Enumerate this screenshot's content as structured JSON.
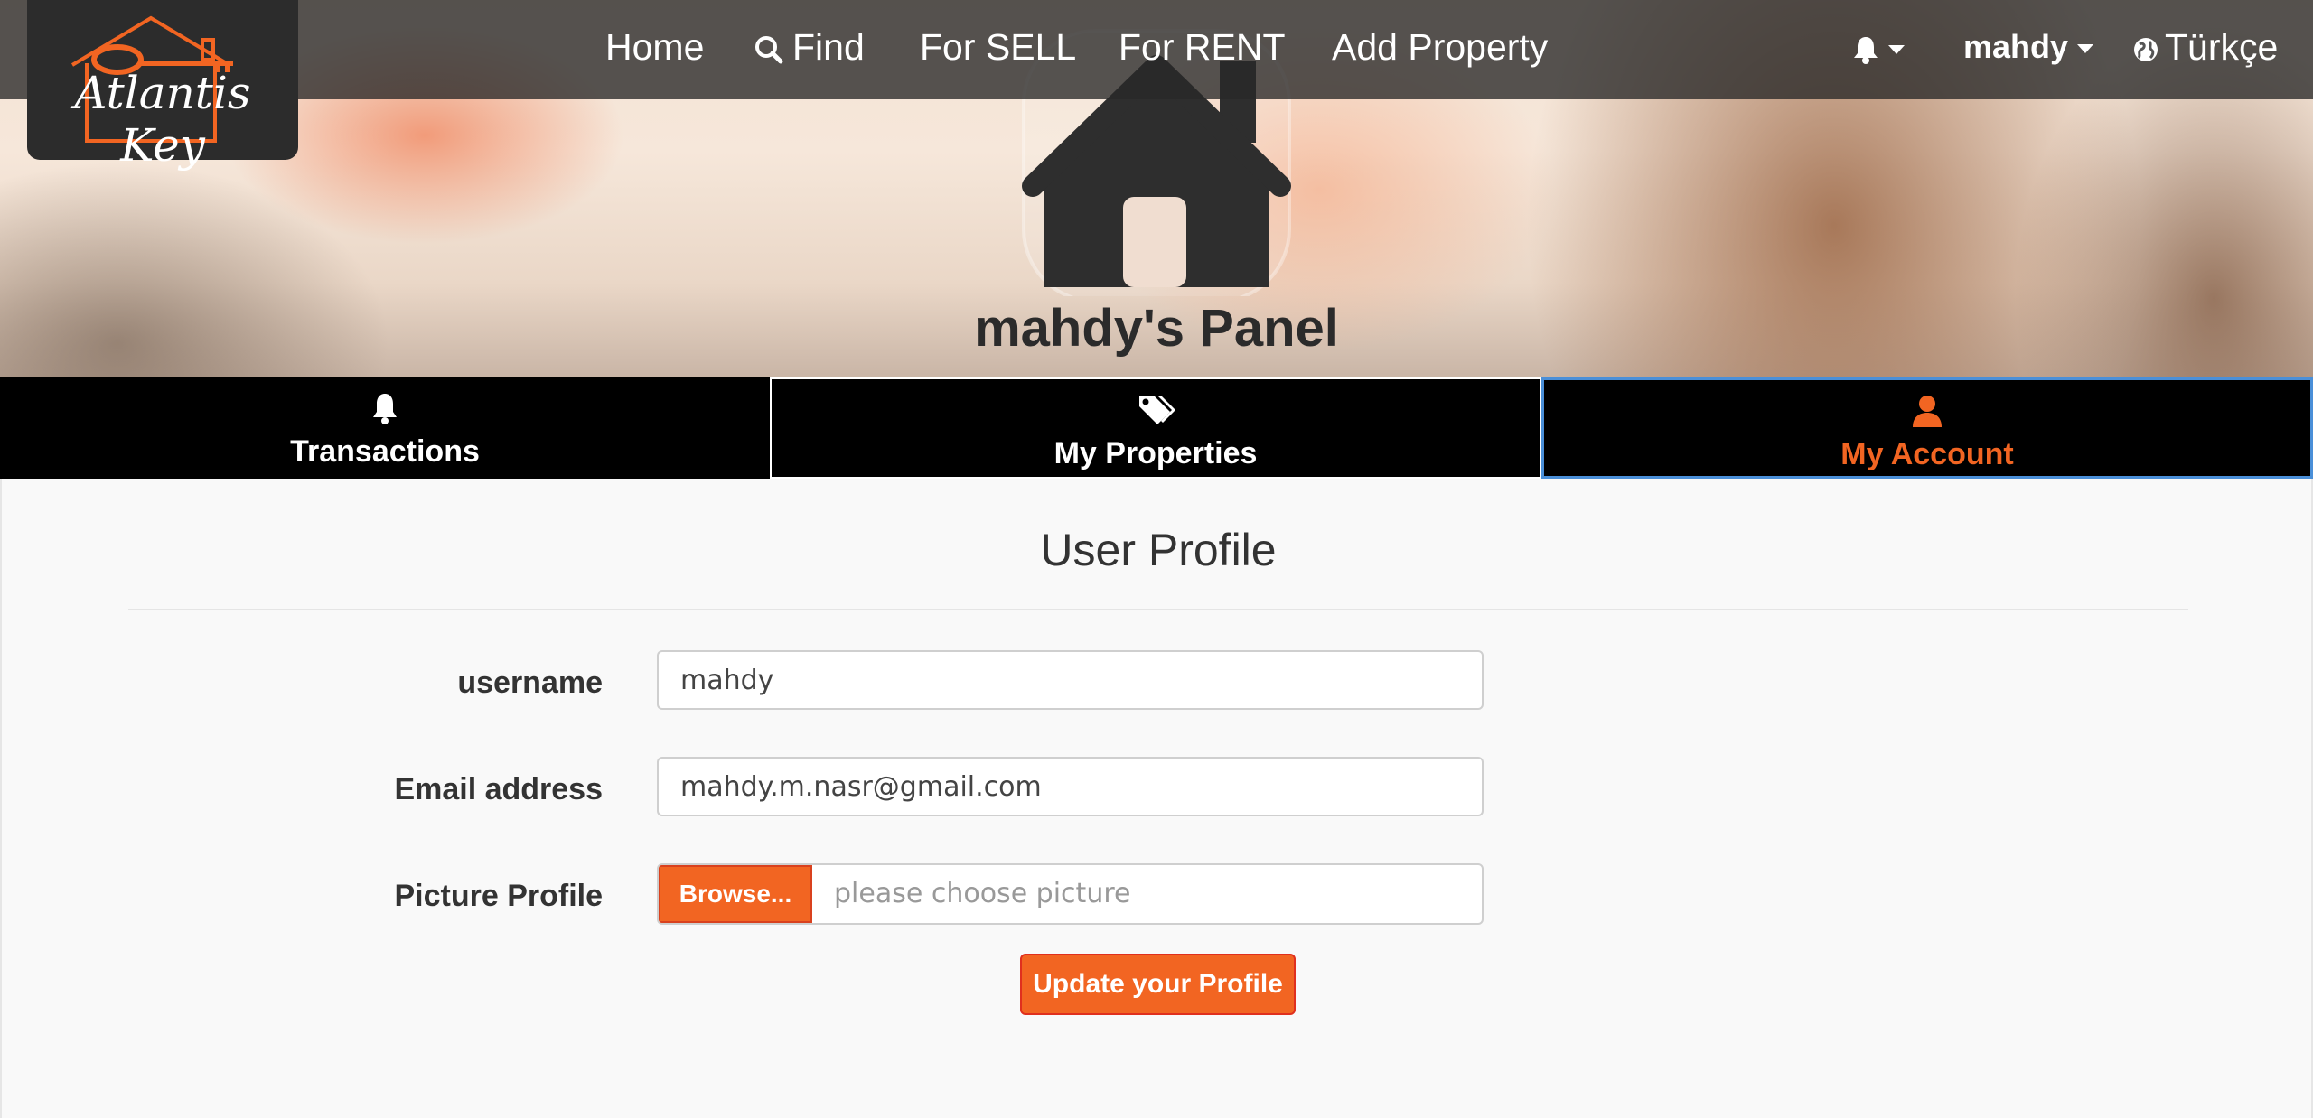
{
  "brand": {
    "name": "Atlantis Key"
  },
  "nav": {
    "links": [
      {
        "label": "Home",
        "icon": null
      },
      {
        "label": "Find",
        "icon": "search-icon"
      },
      {
        "label": "For SELL",
        "icon": null
      },
      {
        "label": "For RENT",
        "icon": null
      },
      {
        "label": "Add Property",
        "icon": null
      }
    ],
    "notifications_icon": "bell-icon",
    "user_menu": "mahdy",
    "language": "Türkçe",
    "language_icon": "globe-icon"
  },
  "hero": {
    "title": "mahdy's Panel"
  },
  "tabs": [
    {
      "label": "Transactions",
      "icon": "bell-icon",
      "active": false
    },
    {
      "label": "My Properties",
      "icon": "tags-icon",
      "active": false
    },
    {
      "label": "My Account",
      "icon": "user-icon",
      "active": true
    }
  ],
  "profile": {
    "title": "User Profile",
    "fields": {
      "username": {
        "label": "username",
        "value": "mahdy"
      },
      "email": {
        "label": "Email address",
        "value": "mahdy.m.nasr@gmail.com"
      },
      "picture": {
        "label": "Picture Profile",
        "browse_label": "Browse...",
        "placeholder": "please choose picture"
      }
    },
    "submit_label": "Update your Profile"
  },
  "colors": {
    "accent": "#f26522",
    "nav_bg": "#282828",
    "tab_active_border": "#4a8fd8"
  }
}
